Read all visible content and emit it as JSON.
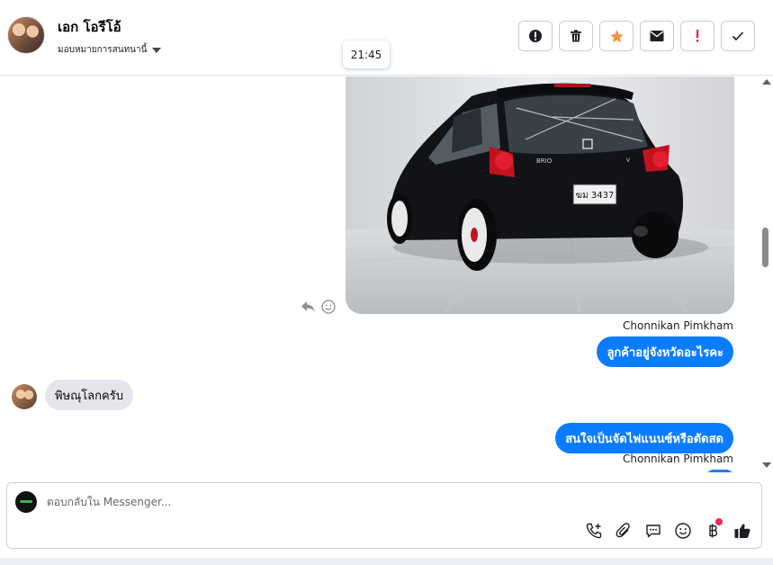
{
  "header": {
    "contact_name": "เอก โอรีโอ้",
    "assign_label": "มอบหมายการสนทนานี้",
    "tooltip_time": "21:45",
    "actions": [
      {
        "name": "report-spam-icon"
      },
      {
        "name": "trash-icon"
      },
      {
        "name": "star-icon"
      },
      {
        "name": "mail-icon"
      },
      {
        "name": "important-icon"
      },
      {
        "name": "check-icon"
      }
    ]
  },
  "colors": {
    "outgoing_bubble": "#0a7cff",
    "incoming_bubble": "#e4e6eb",
    "star": "#f7923a",
    "important": "#f02849"
  },
  "messages": [
    {
      "type": "image",
      "direction": "out",
      "alt": "รถ Honda Brio สีดำ",
      "plate": "ฆม 3437"
    },
    {
      "type": "text",
      "direction": "out",
      "sender": "Chonnikan Pimkham",
      "text": "ลูกค้าอยู่จังหวัดอะไรคะ"
    },
    {
      "type": "text",
      "direction": "in",
      "text": "พิษณุโลกครับ"
    },
    {
      "type": "text",
      "direction": "out",
      "sender": "Chonnikan Pimkham",
      "text": "สนใจเป็นจัดไฟแนนซ์หรือตัดสด"
    }
  ],
  "composer": {
    "placeholder": "ตอบกลับใน Messenger...",
    "tools": [
      "phone-plus-icon",
      "paperclip-icon",
      "saved-reply-icon",
      "emoji-icon",
      "baht-payment-icon",
      "thumbs-up-icon"
    ]
  }
}
